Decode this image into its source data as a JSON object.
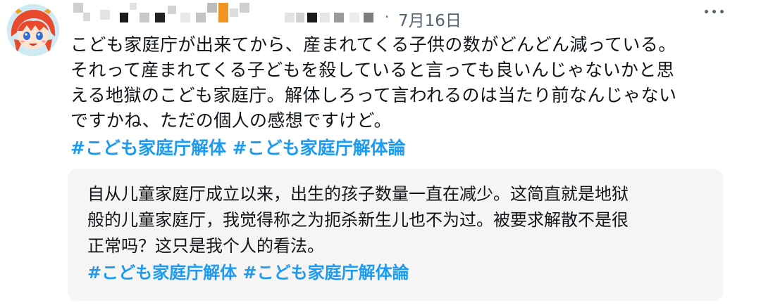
{
  "post": {
    "date": "7月16日",
    "separator": "·",
    "text_lines": [
      "こども家庭庁が出来てから、産まれてくる子供の数がどんどん減っている。",
      "それって産まれてくる子どもを殺していると言っても良いんじゃないかと思",
      "える地獄のこども家庭庁。解体しろって言われるのは当たり前なんじゃない",
      "ですかね、ただの個人の感想ですけど。"
    ],
    "hashtags": [
      "#こども家庭庁解体",
      "#こども家庭庁解体論"
    ]
  },
  "translation": {
    "text_lines": [
      "自从儿童家庭厅成立以来，出生的孩子数量一直在减少。这简直就是地狱",
      "般的儿童家庭厅，我觉得称之为扼杀新生儿也不为过。被要求解散不是很",
      "正常吗？这只是我个人的看法。"
    ],
    "hashtags": [
      "#こども家庭庁解体",
      "#こども家庭庁解体論"
    ]
  },
  "icons": {
    "avatar": "avatar-anime-character",
    "more": "more-options-icon"
  },
  "colors": {
    "hashtag": "#1d9bf0",
    "meta_text": "#536471",
    "body_text": "#0f1419",
    "translation_bg": "#f7f4f4"
  }
}
